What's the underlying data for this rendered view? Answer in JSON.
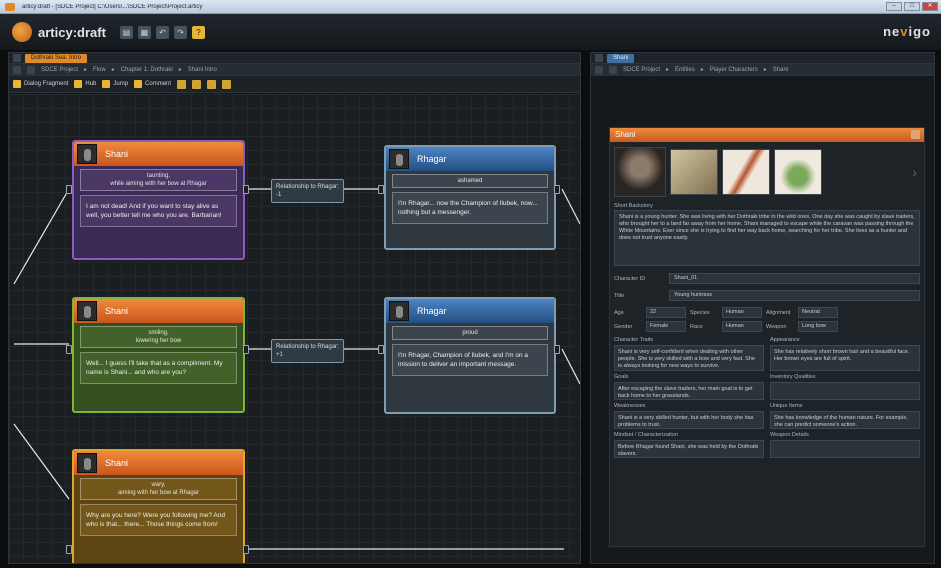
{
  "window": {
    "title": "articy:draft - [SDCE Project] C:\\Users\\...\\SDCE Project\\Project.articy"
  },
  "app": {
    "logo": "articy:draft",
    "brand_prefix": "ne",
    "brand_accent": "v",
    "brand_suffix": "igo",
    "accent_color": "#e08a2a"
  },
  "left_panel": {
    "tab": "Dothraki Sea: Intro",
    "breadcrumbs": [
      "SDCE Project",
      "Flow",
      "Chapter 1: Dothraki",
      "Shani Intro"
    ],
    "tools": [
      "Dialog Fragment",
      "Hub",
      "Jump",
      "Comment"
    ],
    "nodes": [
      {
        "id": "shani1",
        "speaker": "Shani",
        "stage": "taunting,\nwhile aiming with her bow at Rhagar",
        "text": "I am not dead! And if you want to stay alive as well, you better tell me who you are. Barbarian!",
        "color": "purple"
      },
      {
        "id": "rhagar1",
        "speaker": "Rhagar",
        "stage": "ashamed",
        "text": "I'm Rhagar... now the Champion of Ilubek, now... nothing but a messenger.",
        "color": "gray"
      },
      {
        "id": "shani2",
        "speaker": "Shani",
        "stage": "smiling,\nlowering her bow",
        "text": "Well... I guess I'll take that as a compliment. My name is Shani... and who are you?",
        "color": "green"
      },
      {
        "id": "rhagar2",
        "speaker": "Rhagar",
        "stage": "proud",
        "text": "I'm Rhagar, Champion of Ilubek, and I'm on a mission to deliver an important message.",
        "color": "gray"
      },
      {
        "id": "shani3",
        "speaker": "Shani",
        "stage": "wary,\naiming with her bow at Rhagar",
        "text": "Why are you here? Were you following me? And who is that... there... Those things come from!",
        "color": "yellow"
      }
    ],
    "jumpers": [
      "Relationship to Rhagar: -1",
      "Relationship to Rhagar: +1"
    ]
  },
  "right_panel": {
    "tab": "Shani",
    "breadcrumbs": [
      "SDCE Project",
      "Entities",
      "Player Characters",
      "Shani"
    ],
    "entity_name": "Shani",
    "bio_label": "Short Backstory",
    "bio": "Shani is a young hunter. She was living with her Dothraki tribe in the wild ones. One day she was caught by slave traders, who brought her to a land far away from her home. Shani managed to escape while the caravan was passing through the White Mountains. Ever since she is trying to find her way back home, searching for her tribe. She lives as a hunter and does not trust anyone easily.",
    "fields": [
      {
        "label": "Character ID",
        "value": "Shani_01"
      },
      {
        "label": "Title",
        "value": "Young huntress"
      }
    ],
    "stats": [
      {
        "label": "Age",
        "value": "22"
      },
      {
        "label": "Species",
        "value": "Human"
      },
      {
        "label": "Alignment",
        "value": "Neutral"
      },
      {
        "label": "Gender",
        "value": "Female"
      },
      {
        "label": "Race",
        "value": "Human"
      },
      {
        "label": "Weapon",
        "value": "Long bow"
      }
    ],
    "sections": [
      {
        "label": "Character Traits",
        "value": "Shani is very self-confident when dealing with other people. She is very skilled with a bow and very fast. She is always looking for new ways to survive."
      },
      {
        "label": "Appearance",
        "value": "She has relatively short brown hair and a beautiful face. Her brown eyes are full of spirit."
      },
      {
        "label": "Goals",
        "value": "After escaping the slave traders, her main goal is to get back home to her grasslands."
      },
      {
        "label": "Inventory Qualities",
        "value": ""
      },
      {
        "label": "Weaknesses",
        "value": "Shani is a very skilled hunter, but with her body she has problems to trust."
      },
      {
        "label": "Unique Items",
        "value": "She has knowledge of the human nature. For example, she can predict someone's action."
      },
      {
        "label": "Mindset / Characterization",
        "value": "Before Rhagar found Shani, she was held by the Dothraki slavers."
      },
      {
        "label": "Weapon Details",
        "value": ""
      }
    ]
  }
}
